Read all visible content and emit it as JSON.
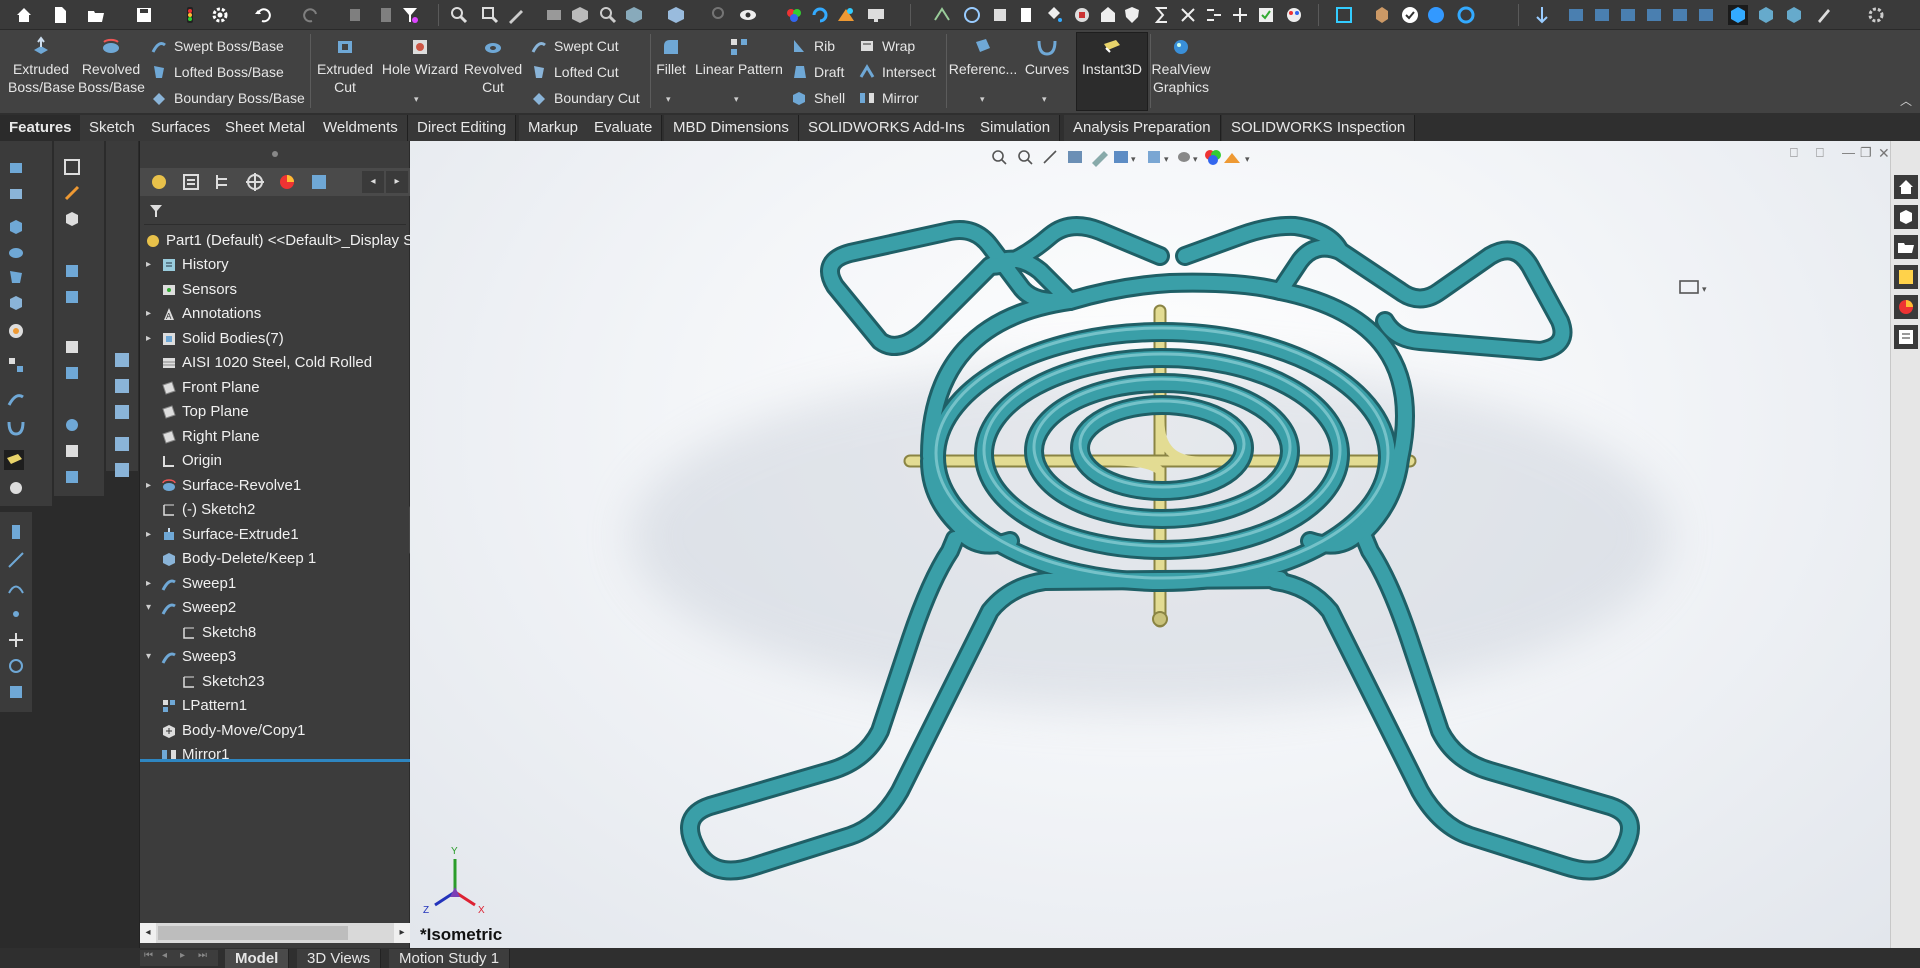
{
  "ribbon": {
    "big": [
      {
        "id": "extruded-boss",
        "line1": "Extruded",
        "line2": "Boss/Base"
      },
      {
        "id": "revolved-boss",
        "line1": "Revolved",
        "line2": "Boss/Base"
      },
      {
        "id": "extruded-cut",
        "line1": "Extruded",
        "line2": "Cut"
      },
      {
        "id": "hole-wizard",
        "line1": "Hole Wizard",
        "line2": ""
      },
      {
        "id": "revolved-cut",
        "line1": "Revolved",
        "line2": "Cut"
      },
      {
        "id": "fillet",
        "line1": "Fillet",
        "line2": ""
      },
      {
        "id": "linear-pattern",
        "line1": "Linear Pattern",
        "line2": ""
      },
      {
        "id": "reference",
        "line1": "Referenc...",
        "line2": ""
      },
      {
        "id": "curves",
        "line1": "Curves",
        "line2": ""
      },
      {
        "id": "instant3d",
        "line1": "Instant3D",
        "line2": ""
      },
      {
        "id": "realview",
        "line1": "RealView",
        "line2": "Graphics"
      }
    ],
    "small": {
      "swept_boss": "Swept Boss/Base",
      "lofted_boss": "Lofted Boss/Base",
      "boundary_boss": "Boundary Boss/Base",
      "swept_cut": "Swept Cut",
      "lofted_cut": "Lofted Cut",
      "boundary_cut": "Boundary Cut",
      "rib": "Rib",
      "draft": "Draft",
      "shell": "Shell",
      "wrap": "Wrap",
      "intersect": "Intersect",
      "mirror": "Mirror"
    }
  },
  "tabs": [
    "Features",
    "Sketch",
    "Surfaces",
    "Sheet Metal",
    "Weldments",
    "Direct Editing",
    "Markup",
    "Evaluate",
    "MBD Dimensions",
    "SOLIDWORKS Add-Ins",
    "Simulation",
    "Analysis Preparation",
    "SOLIDWORKS Inspection"
  ],
  "active_tab": "Features",
  "tree": {
    "root": "Part1 (Default) <<Default>_Display S",
    "items": [
      {
        "label": "History",
        "expand": "▸",
        "indent": 0,
        "icon": "history-icon"
      },
      {
        "label": "Sensors",
        "expand": "",
        "indent": 0,
        "icon": "sensors-icon"
      },
      {
        "label": "Annotations",
        "expand": "▸",
        "indent": 0,
        "icon": "annotations-icon"
      },
      {
        "label": "Solid Bodies(7)",
        "expand": "▸",
        "indent": 0,
        "icon": "solid-bodies-icon"
      },
      {
        "label": "AISI 1020 Steel, Cold Rolled",
        "expand": "",
        "indent": 0,
        "icon": "material-icon"
      },
      {
        "label": "Front Plane",
        "expand": "",
        "indent": 0,
        "icon": "plane-icon"
      },
      {
        "label": "Top Plane",
        "expand": "",
        "indent": 0,
        "icon": "plane-icon"
      },
      {
        "label": "Right Plane",
        "expand": "",
        "indent": 0,
        "icon": "plane-icon"
      },
      {
        "label": "Origin",
        "expand": "",
        "indent": 0,
        "icon": "origin-icon"
      },
      {
        "label": "Surface-Revolve1",
        "expand": "▸",
        "indent": 0,
        "icon": "surface-revolve-icon"
      },
      {
        "label": "(-) Sketch2",
        "expand": "",
        "indent": 0,
        "icon": "sketch-icon"
      },
      {
        "label": "Surface-Extrude1",
        "expand": "▸",
        "indent": 0,
        "icon": "surface-extrude-icon"
      },
      {
        "label": "Body-Delete/Keep 1",
        "expand": "",
        "indent": 0,
        "icon": "body-delete-icon"
      },
      {
        "label": "Sweep1",
        "expand": "▸",
        "indent": 0,
        "icon": "sweep-icon"
      },
      {
        "label": "Sweep2",
        "expand": "▾",
        "indent": 0,
        "icon": "sweep-icon"
      },
      {
        "label": "Sketch8",
        "expand": "",
        "indent": 1,
        "icon": "sketch-icon"
      },
      {
        "label": "Sweep3",
        "expand": "▾",
        "indent": 0,
        "icon": "sweep-icon"
      },
      {
        "label": "Sketch23",
        "expand": "",
        "indent": 1,
        "icon": "sketch-icon"
      },
      {
        "label": "LPattern1",
        "expand": "",
        "indent": 0,
        "icon": "linear-pattern-icon"
      },
      {
        "label": "Body-Move/Copy1",
        "expand": "",
        "indent": 0,
        "icon": "body-move-icon"
      },
      {
        "label": "Mirror1",
        "expand": "",
        "indent": 0,
        "icon": "mirror-icon"
      }
    ]
  },
  "viewport": {
    "orientation": "*Isometric",
    "triad": {
      "x": "X",
      "y": "Y",
      "z": "Z"
    },
    "model_color": "#3a9fa8",
    "rod_color": "#d8d28a"
  },
  "bottom_tabs": [
    "Model",
    "3D Views",
    "Motion Study 1"
  ],
  "active_bottom_tab": "Model"
}
